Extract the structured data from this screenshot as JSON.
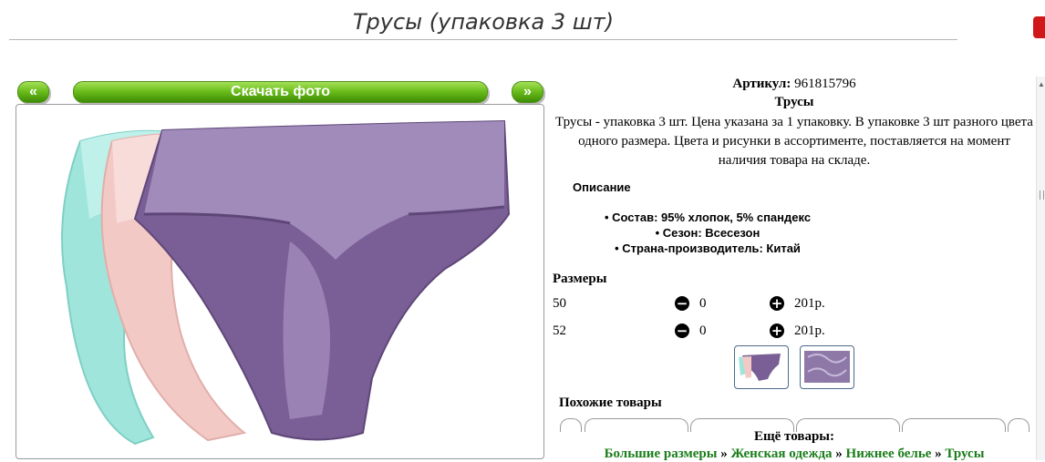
{
  "page": {
    "title": "Трусы (упаковка 3 шт)"
  },
  "nav": {
    "prev_label": "«",
    "download_label": "Скачать фото",
    "next_label": "»"
  },
  "product": {
    "article_label": "Артикул:",
    "article_value": "961815796",
    "name": "Трусы",
    "description": "Трусы - упаковка 3 шт. Цена указана за 1 упаковку. В упаковке 3 шт разного цвета одного размера. Цвета и рисунки в ассортименте, поставляется на момент наличия товара на складе.",
    "desc_heading": "Описание",
    "specs": [
      "Состав: 95% хлопок, 5% спандекс",
      "Сезон: Всесезон",
      "Страна-производитель: Китай"
    ]
  },
  "sizes": {
    "heading": "Размеры",
    "rows": [
      {
        "size": "50",
        "qty": "0",
        "price": "201р."
      },
      {
        "size": "52",
        "qty": "0",
        "price": "201р."
      }
    ]
  },
  "similar": {
    "heading": "Похожие товары"
  },
  "more": {
    "heading": "Ещё товары:",
    "crumbs": [
      "Большие размеры",
      "Женская одежда",
      "Нижнее белье",
      "Трусы"
    ],
    "separator": "»"
  },
  "colors": {
    "accent_green": "#6cbf1d",
    "link_green": "#1a7d1a",
    "purple": "#7a5f96",
    "pink": "#f3c9c6",
    "mint": "#9fe5dc"
  },
  "icons": {
    "minus": "minus-circle-icon",
    "plus": "plus-circle-icon"
  }
}
